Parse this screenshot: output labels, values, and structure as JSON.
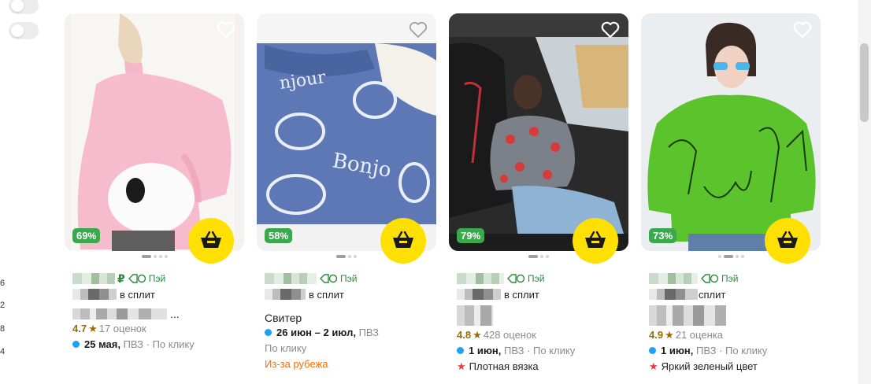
{
  "sidebar_numbers": [
    "6",
    "2",
    "8",
    "4"
  ],
  "colors": {
    "discount_bg": "#3aa84c",
    "cart_bg": "#ffe000",
    "pay_green": "#2b8a3e",
    "rating": "#9a6b00",
    "delivery_dot": "#1ea1f2",
    "abroad": "#ff6a00"
  },
  "icons": {
    "favorite": "heart-outline-icon",
    "cart": "basket-icon",
    "pay": "pay-card-icon",
    "feature": "star-icon"
  },
  "products": [
    {
      "discount": "69",
      "pct": "%",
      "currency": "₽",
      "pay_label": "Пэй",
      "split_label": "в сплит",
      "name_suffix": "...",
      "rating": "4.7",
      "star": "★",
      "reviews": "17 оценок",
      "delivery_date": "25 мая,",
      "delivery_info": "ПВЗ · По клику"
    },
    {
      "discount": "58",
      "pct": "%",
      "pay_label": "Пэй",
      "split_label": "в сплит",
      "title": "Свитер",
      "delivery_date": "26 июн – 2 июл,",
      "delivery_info": "ПВЗ",
      "delivery_info2": "По клику",
      "abroad": "Из-за рубежа"
    },
    {
      "discount": "79",
      "pct": "%",
      "pay_label": "Пэй",
      "split_label": "в сплит",
      "rating": "4.8",
      "star": "★",
      "reviews": "428 оценок",
      "delivery_date": "1 июн,",
      "delivery_info": "ПВЗ · По клику",
      "feature": "Плотная вязка"
    },
    {
      "discount": "73",
      "pct": "%",
      "pay_label": "Пэй",
      "split_label": "сплит",
      "rating": "4.9",
      "star": "★",
      "reviews": "21 оценка",
      "delivery_date": "1 июн,",
      "delivery_info": "ПВЗ · По клику",
      "feature": "Яркий зеленый цвет"
    }
  ]
}
